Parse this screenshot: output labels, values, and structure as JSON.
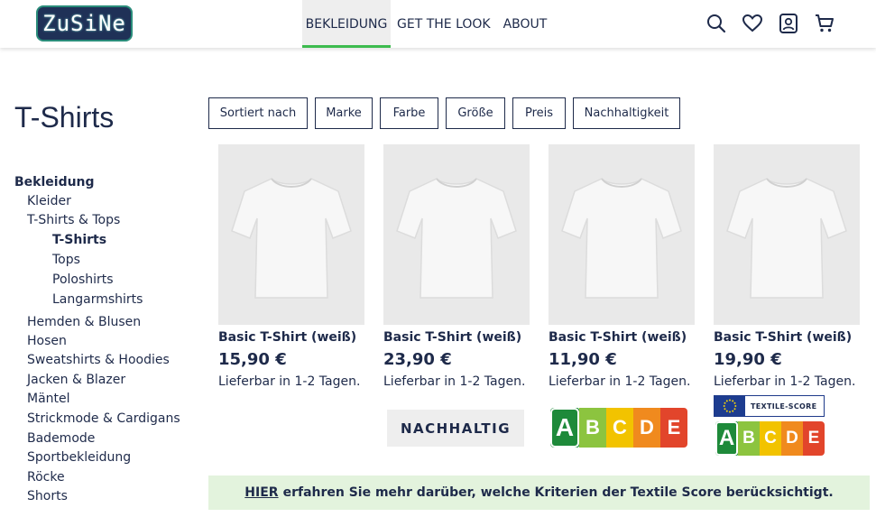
{
  "header": {
    "logo_text": "ZuSiNe",
    "nav": [
      "BEKLEIDUNG",
      "GET THE LOOK",
      "ABOUT"
    ],
    "icons": [
      "search-icon",
      "heart-icon",
      "user-icon",
      "cart-icon"
    ]
  },
  "page": {
    "title": "T-Shirts"
  },
  "sidebar": {
    "root": "Bekleidung",
    "items": [
      "Kleider",
      "T-Shirts & Tops",
      "T-Shirts",
      "Tops",
      "Poloshirts",
      "Langarmshirts",
      "Hemden & Blusen",
      "Hosen",
      "Sweatshirts & Hoodies",
      "Jacken & Blazer",
      "Mäntel",
      "Strickmode & Cardigans",
      "Bademode",
      "Sportbekleidung",
      "Röcke",
      "Shorts"
    ]
  },
  "filters": [
    "Sortiert nach",
    "Marke",
    "Farbe",
    "Größe",
    "Preis",
    "Nachhaltigkeit"
  ],
  "products": [
    {
      "name": "Basic T-Shirt (weiß)",
      "price": "15,90 €",
      "delivery": "Lieferbar in 1-2 Tagen."
    },
    {
      "name": "Basic T-Shirt (weiß)",
      "price": "23,90 €",
      "delivery": "Lieferbar in 1-2 Tagen."
    },
    {
      "name": "Basic T-Shirt (weiß)",
      "price": "11,90 €",
      "delivery": "Lieferbar in 1-2 Tagen."
    },
    {
      "name": "Basic T-Shirt (weiß)",
      "price": "19,90 €",
      "delivery": "Lieferbar in 1-2 Tagen."
    }
  ],
  "badges": {
    "nachhaltig": "NACHHALTIG",
    "textile_score_label": "TEXTILE-SCORE",
    "score_letters": [
      "A",
      "B",
      "C",
      "D",
      "E"
    ],
    "score_colors": [
      "#1e8a3a",
      "#8cc43f",
      "#f2c300",
      "#f08a1e",
      "#e2452b"
    ],
    "score_selected": "A"
  },
  "info": {
    "link": "HIER",
    "text": "erfahren Sie mehr darüber, welche Kriterien der Textile Score berücksichtigt."
  },
  "colors": {
    "brand_navy": "#1e2a4a",
    "accent_green": "#3dbb4e",
    "info_bg": "#e3f3dd"
  }
}
